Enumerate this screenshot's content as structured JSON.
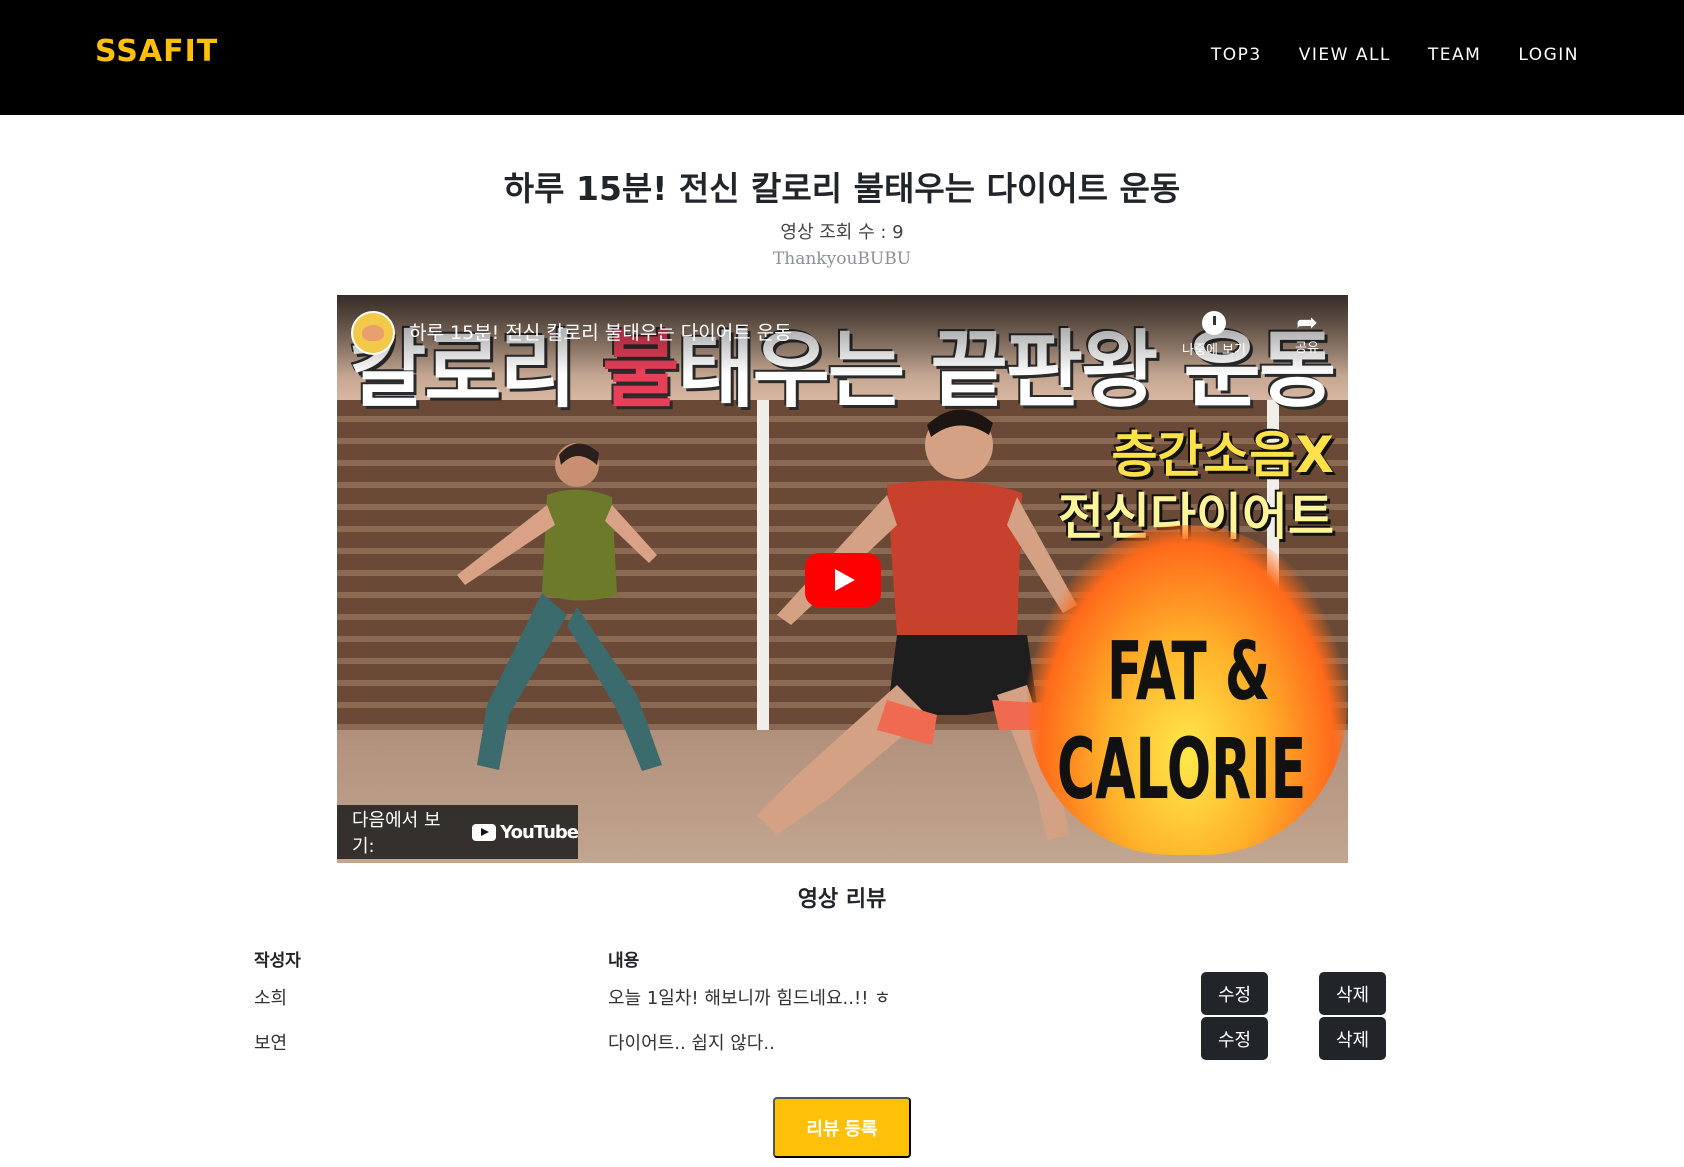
{
  "header": {
    "brand": "SSAFIT",
    "nav": [
      "TOP3",
      "VIEW ALL",
      "TEAM",
      "LOGIN"
    ]
  },
  "video": {
    "title": "하루 15분! 전신 칼로리 불태우는 다이어트 운동",
    "view_count": "영상 조회 수 : 9",
    "channel": "ThankyouBUBU",
    "player": {
      "overlay_title": "하루 15분! 전신 칼로리 불태우는 다이어트 운동",
      "watch_later": "나중에 보기",
      "share": "공유",
      "watch_on_label": "다음에서 보기:",
      "youtube_wordmark": "YouTube",
      "thumbnail_banner_pre": "칼로리 ",
      "thumbnail_banner_red": "불",
      "thumbnail_banner_post": "태우는 끝판왕 운동",
      "thumbnail_promo_1": "층간소음X",
      "thumbnail_promo_2": "전신다이어트",
      "thumbnail_fat": "FAT &",
      "thumbnail_calorie": "CALORIE"
    }
  },
  "reviews": {
    "heading": "영상 리뷰",
    "columns": {
      "author": "작성자",
      "content": "내용"
    },
    "rows": [
      {
        "author": "소희",
        "content": "오늘 1일차! 해보니까 힘드네요..!! ㅎ",
        "edit": "수정",
        "delete": "삭제"
      },
      {
        "author": "보연",
        "content": "다이어트.. 쉽지 않다..",
        "edit": "수정",
        "delete": "삭제"
      }
    ],
    "register_button": "리뷰 등록"
  },
  "colors": {
    "brand": "#ffc107",
    "header_bg": "#000000",
    "dark_button": "#212529",
    "youtube_red": "#ff0000"
  }
}
